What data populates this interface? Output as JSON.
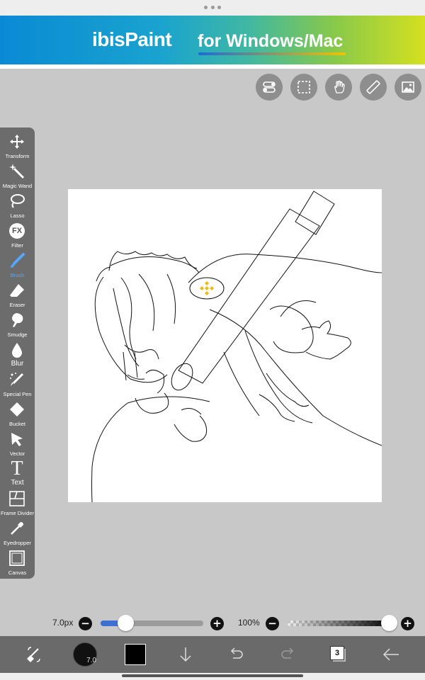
{
  "banner": {
    "logo_text": "ibisPaint",
    "tagline": "for Windows/Mac"
  },
  "top_buttons": [
    "toggle-icon",
    "selection-icon",
    "hand-icon",
    "ruler-icon",
    "image-icon"
  ],
  "toolbar": {
    "tools": [
      {
        "label": "Transform",
        "icon": "move-icon"
      },
      {
        "label": "Magic Wand",
        "icon": "magic-wand-icon"
      },
      {
        "label": "Lasso",
        "icon": "lasso-icon"
      },
      {
        "label": "Filter",
        "icon": "fx-icon"
      },
      {
        "label": "Brush",
        "icon": "brush-icon",
        "active": true
      },
      {
        "label": "Eraser",
        "icon": "eraser-icon"
      },
      {
        "label": "Smudge",
        "icon": "smudge-icon"
      },
      {
        "label": "Blur",
        "icon": "blur-drop-icon"
      },
      {
        "label": "Special Pen",
        "icon": "special-pen-icon"
      },
      {
        "label": "Bucket",
        "icon": "bucket-icon"
      },
      {
        "label": "Vector",
        "icon": "vector-arrow-icon"
      },
      {
        "label": "Text",
        "icon": "text-icon"
      },
      {
        "label": "Frame Divider",
        "icon": "frame-divider-icon"
      },
      {
        "label": "Eyedropper",
        "icon": "eyedropper-icon"
      },
      {
        "label": "Canvas",
        "icon": "canvas-icon"
      }
    ],
    "filter_icon_text": "FX",
    "text_icon_text": "T"
  },
  "sliders": {
    "brush_size_label": "7.0px",
    "brush_size_fraction": 0.24,
    "opacity_label": "100%",
    "opacity_fraction": 1.0,
    "minus": "−",
    "plus": "+"
  },
  "bottom_bar": {
    "brush_size_badge": "7.0",
    "layer_count": "3",
    "color_swatch": "#000000"
  },
  "colors": {
    "accent": "#58a6ff",
    "toolbar_bg": "#6c6c6c",
    "binance_yellow": "#f0b90b"
  }
}
